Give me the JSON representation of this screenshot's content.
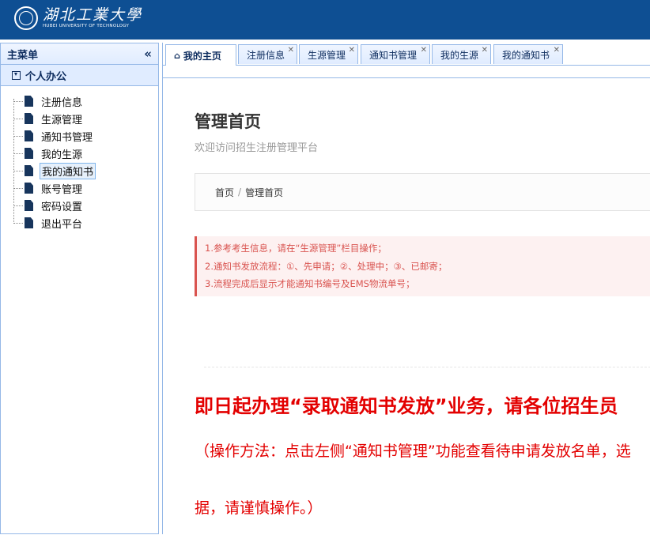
{
  "header": {
    "logo_cn": "湖北工業大學",
    "logo_en": "HUBEI UNIVERSITY OF TECHNOLOGY",
    "bg_color": "#0e4f93"
  },
  "sidebar": {
    "title": "主菜单",
    "collapse_icon": "«",
    "group_label": "个人办公",
    "items": [
      {
        "label": "注册信息"
      },
      {
        "label": "生源管理"
      },
      {
        "label": "通知书管理"
      },
      {
        "label": "我的生源"
      },
      {
        "label": "我的通知书",
        "selected": true
      },
      {
        "label": "账号管理"
      },
      {
        "label": "密码设置"
      },
      {
        "label": "退出平台"
      }
    ]
  },
  "tabs": [
    {
      "label": "我的主页",
      "icon": "home-icon",
      "active": true,
      "closable": false
    },
    {
      "label": "注册信息",
      "closable": true
    },
    {
      "label": "生源管理",
      "closable": true
    },
    {
      "label": "通知书管理",
      "closable": true
    },
    {
      "label": "我的生源",
      "closable": true
    },
    {
      "label": "我的通知书",
      "closable": true
    }
  ],
  "page": {
    "title": "管理首页",
    "subtitle": "欢迎访问招生注册管理平台",
    "breadcrumb": [
      "首页",
      "管理首页"
    ],
    "notices": [
      "1.参考考生信息，请在“生源管理”栏目操作；",
      "2.通知书发放流程：①、先申请；②、处理中；③、已邮寄；",
      "3.流程完成后显示才能通知书编号及EMS物流单号；"
    ],
    "headline": "即日起办理“录取通知书发放”业务，请各位招生员",
    "detail_line1": "（操作方法：点击左侧“通知书管理”功能查看待申请发放名单，选",
    "detail_line2": "据，请谨慎操作。）",
    "accent_color": "#e30000"
  }
}
